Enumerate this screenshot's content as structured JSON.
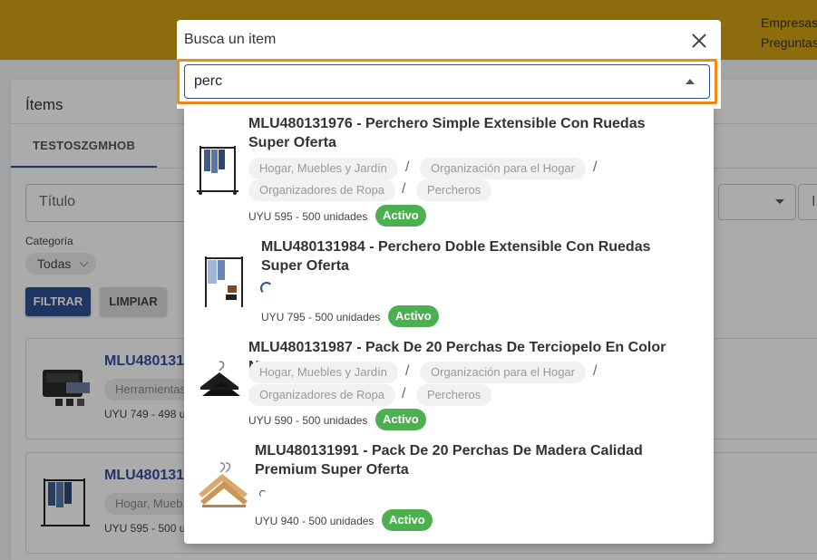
{
  "header": {
    "links": [
      "Empresas",
      "Preguntas"
    ]
  },
  "panel": {
    "title": "Ítems",
    "tab": "TESTOSZGMHOB",
    "title_field": "Título",
    "right_field": "I",
    "category_label": "Categoría",
    "category_value": "Todas",
    "filter_button": "FILTRAR",
    "clear_button": "LIMPIAR",
    "cards": [
      {
        "title": "MLU480131",
        "chip": "Herramientas",
        "price": "UYU 749 - 498 u"
      },
      {
        "title": "MLU480131",
        "chip": "Hogar, Mueb",
        "price": "UYU 595 - 500 u"
      }
    ]
  },
  "modal": {
    "title": "Busca un item",
    "search_value": "perc"
  },
  "results": [
    {
      "title": "MLU480131976 - Perchero Simple Extensible Con Ruedas Super Oferta",
      "categories": [
        "Hogar, Muebles y Jardín",
        "Organización para el Hogar",
        "Organizadores de Ropa",
        "Percheros"
      ],
      "price": "UYU 595 - 500 unidades",
      "status": "Activo"
    },
    {
      "title": "MLU480131984 - Perchero Doble Extensible Con Ruedas Super Oferta",
      "categories": [],
      "price": "UYU 795 - 500 unidades",
      "status": "Activo"
    },
    {
      "title": "MLU480131987 - Pack De 20 Perchas De Terciopelo En Color Negro",
      "categories": [
        "Hogar, Muebles y Jardín",
        "Organización para el Hogar",
        "Organizadores de Ropa",
        "Percheros"
      ],
      "price": "UYU 590 - 500 unidades",
      "status": "Activo"
    },
    {
      "title": "MLU480131991 - Pack De 20 Perchas De Madera Calidad Premium Super Oferta",
      "categories": [],
      "price": "UYU 940 - 500 unidades",
      "status": "Activo"
    }
  ],
  "colors": {
    "accent": "#2f4f96",
    "topbar": "#d1a114",
    "highlight": "#f28b12",
    "active": "#4caf50"
  }
}
